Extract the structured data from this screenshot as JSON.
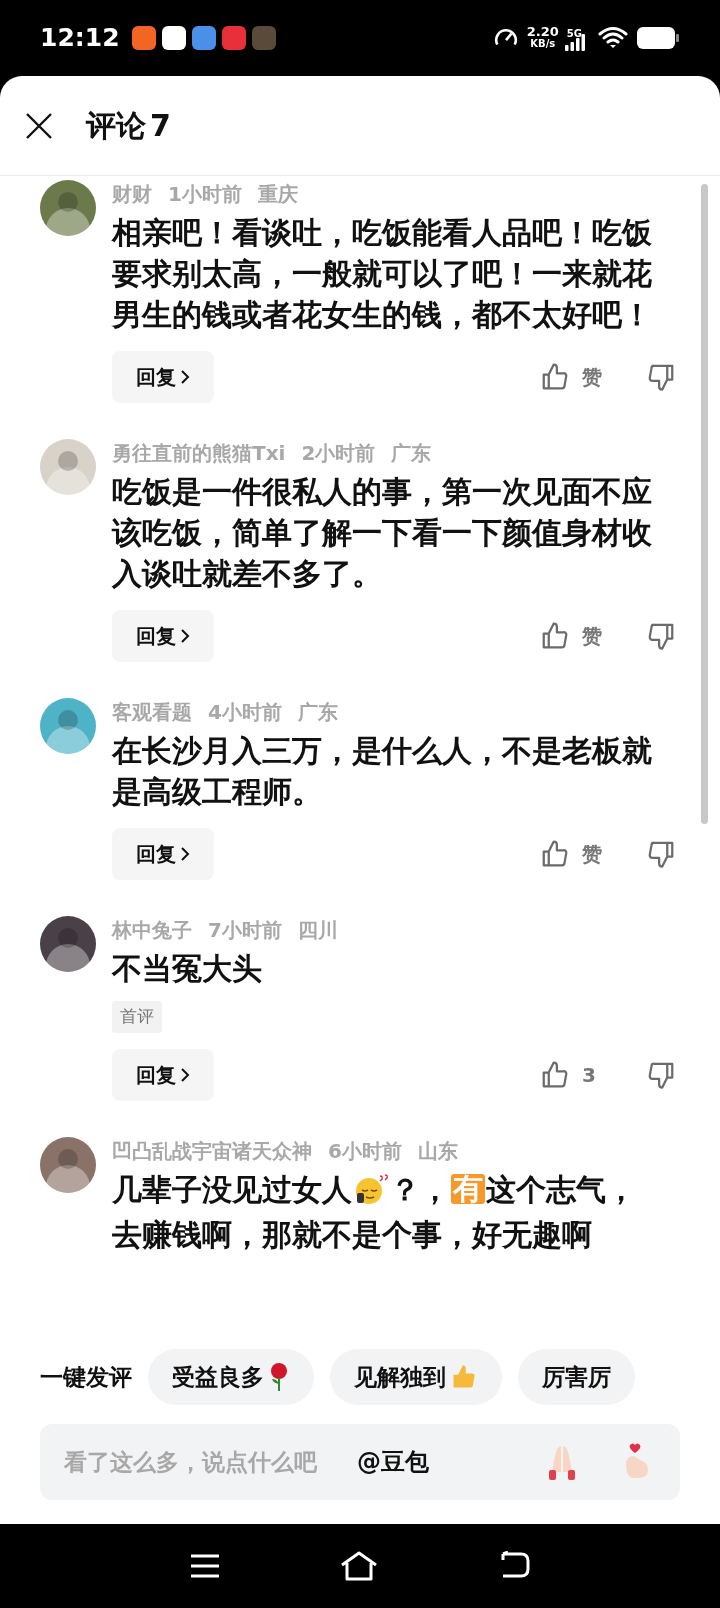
{
  "status_bar": {
    "time": "12:12",
    "speed_value": "2.20",
    "speed_unit": "KB/s",
    "network": "5G"
  },
  "header": {
    "title": "评论",
    "count": "7"
  },
  "comments": [
    {
      "user": "财财",
      "time": "1小时前",
      "location": "重庆",
      "segments": [
        {
          "kind": "text",
          "text": "相亲吧！看谈吐，吃饭能看人品吧！吃饭要求别太高，一般就可以了吧！一来就花男生的钱或者花女生的钱，都不太好吧！"
        }
      ],
      "reply": "回复",
      "likes": "赞"
    },
    {
      "user": "勇往直前的熊猫Txi",
      "time": "2小时前",
      "location": "广东",
      "segments": [
        {
          "kind": "text",
          "text": "吃饭是一件很私人的事，第一次见面不应该吃饭，简单了解一下看一下颜值身材收入谈吐就差不多了。"
        }
      ],
      "reply": "回复",
      "likes": "赞"
    },
    {
      "user": "客观看题",
      "time": "4小时前",
      "location": "广东",
      "segments": [
        {
          "kind": "text",
          "text": "在长沙月入三万，是什么人，不是老板就是高级工程师。"
        }
      ],
      "reply": "回复",
      "likes": "赞"
    },
    {
      "user": "林中兔子",
      "time": "7小时前",
      "location": "四川",
      "segments": [
        {
          "kind": "text",
          "text": "不当冤大头"
        }
      ],
      "tag": "首评",
      "reply": "回复",
      "likes": "3"
    },
    {
      "user": "凹凸乱战宇宙诸天众神",
      "time": "6小时前",
      "location": "山东",
      "lines": [
        [
          {
            "kind": "text",
            "text": "几辈子没见过女人"
          },
          {
            "kind": "emoji"
          },
          {
            "kind": "text",
            "text": "？，"
          },
          {
            "kind": "badge",
            "text": "有"
          },
          {
            "kind": "text",
            "text": "这个志气，"
          }
        ],
        [
          {
            "kind": "text",
            "text": "去赚钱啊，那就不是个事，好无趣啊"
          }
        ]
      ]
    }
  ],
  "quick_comment": {
    "label": "一键发评",
    "chips": [
      {
        "text": "受益良多"
      },
      {
        "text": "见解独到"
      },
      {
        "text": "厉害厉"
      }
    ]
  },
  "input": {
    "placeholder": "看了这么多，说点什么吧",
    "mention": "@豆包"
  }
}
